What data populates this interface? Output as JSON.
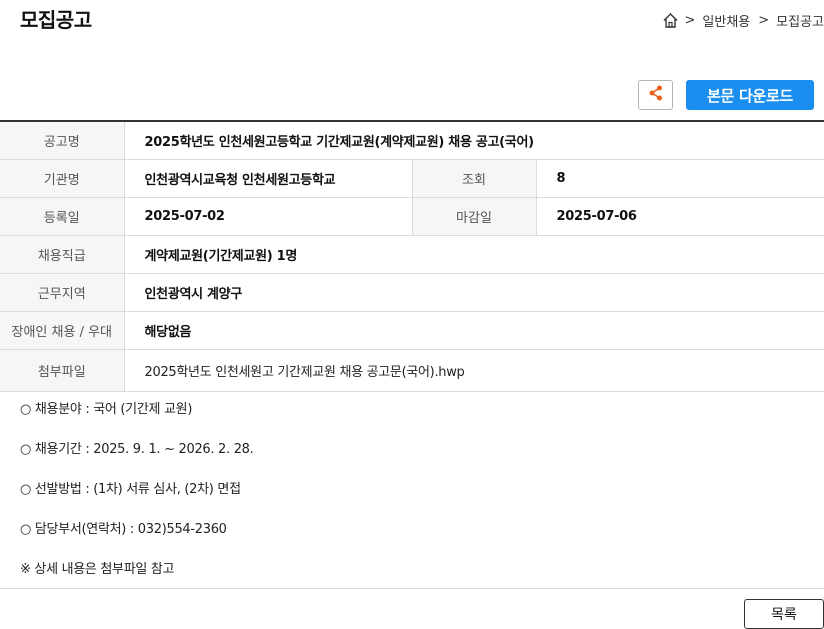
{
  "header": {
    "title": "모집공고",
    "breadcrumb": {
      "separator": ">",
      "items": [
        "일반채용",
        "모집공고"
      ]
    }
  },
  "actions": {
    "share_icon": "share-icon",
    "download_label": "본문 다운로드",
    "download_color": "#1a8ff0"
  },
  "info": {
    "title_label": "공고명",
    "title_value": "2025학년도 인천세원고등학교 기간제교원(계약제교원) 채용 공고(국어)",
    "org_label": "기관명",
    "org_value": "인천광역시교육청 인천세원고등학교",
    "views_label": "조회",
    "views_value": "8",
    "reg_label": "등록일",
    "reg_value": "2025-07-02",
    "deadline_label": "마감일",
    "deadline_value": "2025-07-06",
    "position_label": "채용직급",
    "position_value": "계약제교원(기간제교원) 1명",
    "location_label": "근무지역",
    "location_value": "인천광역시 계양구",
    "disability_label": "장애인 채용 / 우대",
    "disability_value": "해당없음",
    "attachment_label": "첨부파일",
    "attachment_value": "2025학년도 인천세원고 기간제교원 채용 공고문(국어).hwp"
  },
  "content": {
    "lines": [
      "○ 채용분야 : 국어 (기간제 교원)",
      "○ 채용기간 : 2025. 9. 1. ~ 2026. 2. 28.",
      "○ 선발방법 : (1차) 서류 심사, (2차) 면접",
      "○ 담당부서(연락처) : 032)554-2360",
      "※ 상세 내용은 첨부파일 참고"
    ]
  },
  "footer": {
    "list_label": "목록"
  }
}
